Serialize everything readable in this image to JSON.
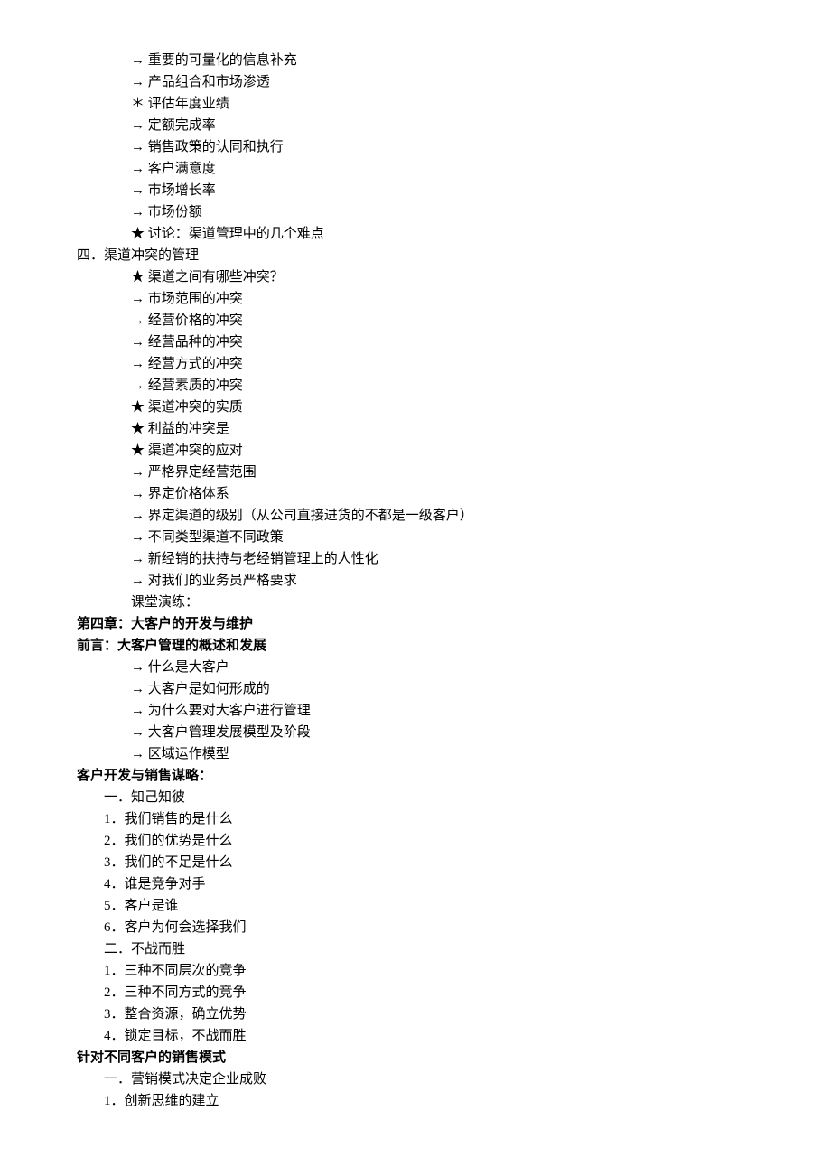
{
  "lines": [
    {
      "indent": 3,
      "bold": false,
      "text": "→ 重要的可量化的信息补充"
    },
    {
      "indent": 3,
      "bold": false,
      "text": "→ 产品组合和市场渗透"
    },
    {
      "indent": 3,
      "bold": false,
      "text": "＊ 评估年度业绩"
    },
    {
      "indent": 3,
      "bold": false,
      "text": "→ 定额完成率"
    },
    {
      "indent": 3,
      "bold": false,
      "text": "→ 销售政策的认同和执行"
    },
    {
      "indent": 3,
      "bold": false,
      "text": "→ 客户满意度"
    },
    {
      "indent": 3,
      "bold": false,
      "text": "→ 市场增长率"
    },
    {
      "indent": 3,
      "bold": false,
      "text": "→ 市场份额"
    },
    {
      "indent": 3,
      "bold": false,
      "text": "★ 讨论：渠道管理中的几个难点"
    },
    {
      "indent": 1,
      "bold": false,
      "text": "四．渠道冲突的管理"
    },
    {
      "indent": 3,
      "bold": false,
      "text": "★ 渠道之间有哪些冲突？"
    },
    {
      "indent": 3,
      "bold": false,
      "text": "→ 市场范围的冲突"
    },
    {
      "indent": 3,
      "bold": false,
      "text": "→ 经营价格的冲突"
    },
    {
      "indent": 3,
      "bold": false,
      "text": "→ 经营品种的冲突"
    },
    {
      "indent": 3,
      "bold": false,
      "text": "→ 经营方式的冲突"
    },
    {
      "indent": 3,
      "bold": false,
      "text": "→ 经营素质的冲突"
    },
    {
      "indent": 3,
      "bold": false,
      "text": "★ 渠道冲突的实质"
    },
    {
      "indent": 3,
      "bold": false,
      "text": "★ 利益的冲突是"
    },
    {
      "indent": 3,
      "bold": false,
      "text": "★ 渠道冲突的应对"
    },
    {
      "indent": 3,
      "bold": false,
      "text": "→ 严格界定经营范围"
    },
    {
      "indent": 3,
      "bold": false,
      "text": "→ 界定价格体系"
    },
    {
      "indent": 3,
      "bold": false,
      "text": "→ 界定渠道的级别（从公司直接进货的不都是一级客户）"
    },
    {
      "indent": 3,
      "bold": false,
      "text": "→ 不同类型渠道不同政策"
    },
    {
      "indent": 3,
      "bold": false,
      "text": "→ 新经销的扶持与老经销管理上的人性化"
    },
    {
      "indent": 3,
      "bold": false,
      "text": "→ 对我们的业务员严格要求"
    },
    {
      "indent": 3,
      "bold": false,
      "text": "课堂演练："
    },
    {
      "indent": 1,
      "bold": true,
      "text": "第四章：大客户的开发与维护"
    },
    {
      "indent": 1,
      "bold": true,
      "text": "前言：大客户管理的概述和发展"
    },
    {
      "indent": 3,
      "bold": false,
      "text": "→ 什么是大客户"
    },
    {
      "indent": 3,
      "bold": false,
      "text": "→ 大客户是如何形成的"
    },
    {
      "indent": 3,
      "bold": false,
      "text": "→ 为什么要对大客户进行管理"
    },
    {
      "indent": 3,
      "bold": false,
      "text": "→ 大客户管理发展模型及阶段"
    },
    {
      "indent": 3,
      "bold": false,
      "text": "→ 区域运作模型"
    },
    {
      "indent": 1,
      "bold": true,
      "text": "客户开发与销售谋略："
    },
    {
      "indent": 2,
      "bold": false,
      "text": "一．知己知彼"
    },
    {
      "indent": 2,
      "bold": false,
      "text": "1．我们销售的是什么"
    },
    {
      "indent": 2,
      "bold": false,
      "text": "2．我们的优势是什么"
    },
    {
      "indent": 2,
      "bold": false,
      "text": "3．我们的不足是什么"
    },
    {
      "indent": 2,
      "bold": false,
      "text": "4．谁是竞争对手"
    },
    {
      "indent": 2,
      "bold": false,
      "text": "5．客户是谁"
    },
    {
      "indent": 2,
      "bold": false,
      "text": "6．客户为何会选择我们"
    },
    {
      "indent": 2,
      "bold": false,
      "text": "二．不战而胜"
    },
    {
      "indent": 2,
      "bold": false,
      "text": "1．三种不同层次的竞争"
    },
    {
      "indent": 2,
      "bold": false,
      "text": "2．三种不同方式的竞争"
    },
    {
      "indent": 2,
      "bold": false,
      "text": "3．整合资源，确立优势"
    },
    {
      "indent": 2,
      "bold": false,
      "text": "4．锁定目标，不战而胜"
    },
    {
      "indent": 1,
      "bold": true,
      "text": "针对不同客户的销售模式"
    },
    {
      "indent": 2,
      "bold": false,
      "text": "一．营销模式决定企业成败"
    },
    {
      "indent": 2,
      "bold": false,
      "text": "1．创新思维的建立"
    }
  ]
}
